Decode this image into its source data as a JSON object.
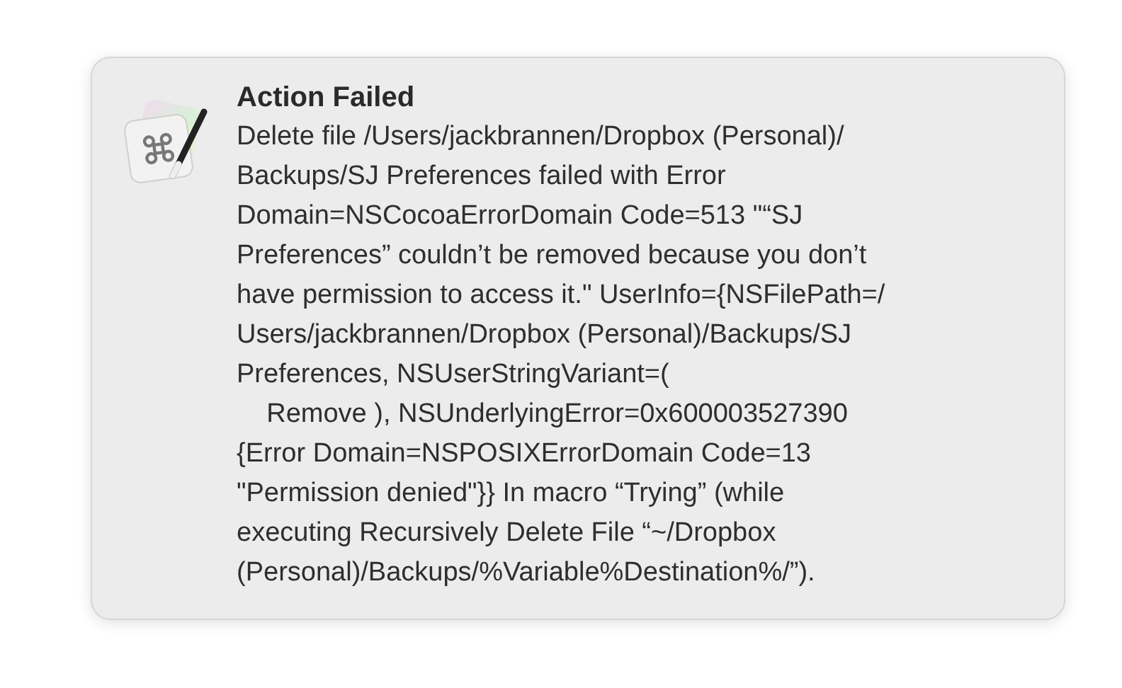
{
  "notification": {
    "title": "Action Failed",
    "message": "Delete file /Users/jackbrannen/Dropbox (Personal)/\nBackups/SJ Preferences failed with Error\nDomain=NSCocoaErrorDomain Code=513 \"“SJ\nPreferences” couldn’t be removed because you don’t\nhave permission to access it.\" UserInfo={NSFilePath=/\nUsers/jackbrannen/Dropbox (Personal)/Backups/SJ\nPreferences, NSUserStringVariant=(\n    Remove ), NSUnderlyingError=0x600003527390\n{Error Domain=NSPOSIXErrorDomain Code=13\n\"Permission denied\"}} In macro “Trying” (while\nexecuting Recursively Delete File “~/Dropbox\n(Personal)/Backups/%Variable%Destination%/”)."
  }
}
